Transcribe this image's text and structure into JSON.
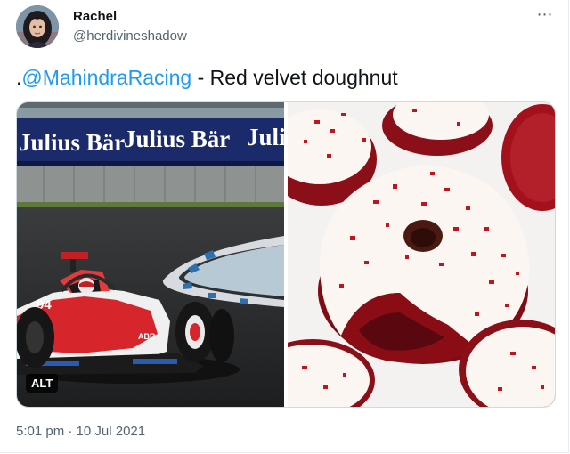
{
  "author": {
    "name": "Rachel",
    "handle": "@herdivineshadow"
  },
  "more_icon": "more-horizontal-icon",
  "tweet": {
    "prefix": ".",
    "mention": "@MahindraRacing",
    "text": " - Red velvet doughnut"
  },
  "media": {
    "left_photo": {
      "banner_text": "Julius Bär",
      "car_number": "94",
      "sponsor_text": "ABB"
    },
    "alt_label": "ALT"
  },
  "meta": {
    "time": "5:01 pm",
    "separator": "·",
    "date": "10 Jul 2021"
  },
  "colors": {
    "mention": "#1d9bf0",
    "secondary_text": "#536471",
    "banner_blue": "#1b2a6b",
    "car_red": "#d6262b",
    "red_velvet": "#a3121c",
    "frosting": "#fbf6f1"
  }
}
